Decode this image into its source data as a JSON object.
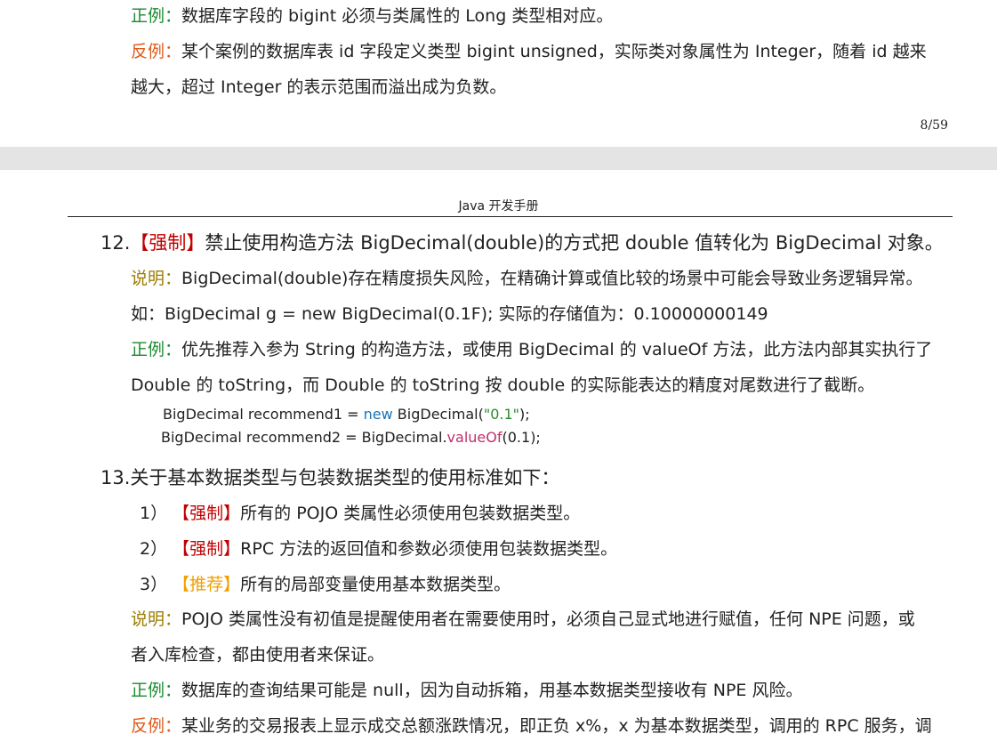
{
  "page_top": {
    "correct_label": "正例：",
    "correct_text": "数据库字段的 bigint 必须与类属性的 Long 类型相对应。",
    "counter_label": "反例：",
    "counter_text_1": "某个案例的数据库表 id 字段定义类型 bigint unsigned，实际类对象属性为 Integer，随着 id 越来",
    "counter_text_2": "越大，超过 Integer 的表示范围而溢出成为负数。",
    "page_number": "8/59"
  },
  "page_bottom": {
    "running_header": "Java 开发手册",
    "item12": {
      "number": "12.",
      "tag": "【强制】",
      "title": "禁止使用构造方法 BigDecimal(double)的方式把 double 值转化为 BigDecimal 对象。",
      "note_label": "说明：",
      "note_text": "BigDecimal(double)存在精度损失风险，在精确计算或值比较的场景中可能会导致业务逻辑异常。",
      "example_line": "如：BigDecimal g = new BigDecimal(0.1F); 实际的存储值为：0.10000000149",
      "correct_label": "正例：",
      "correct_text_1": "优先推荐入参为 String 的构造方法，或使用 BigDecimal 的 valueOf 方法，此方法内部其实执行了",
      "correct_text_2": "Double 的 toString，而 Double 的 toString 按 double 的实际能表达的精度对尾数进行了截断。",
      "code1": {
        "a": "BigDecimal recommend1 = ",
        "kw": "new",
        "b": " BigDecimal(",
        "str": "\"0.1\"",
        "c": ");"
      },
      "code2": {
        "a": "BigDecimal recommend2 = BigDecimal.",
        "fn": "valueOf",
        "b": "(",
        "num": "0.1",
        "c": ");"
      }
    },
    "item13": {
      "title": "13.关于基本数据类型与包装数据类型的使用标准如下：",
      "subs": [
        {
          "num": "1）",
          "tag": "【强制】",
          "text": "所有的 POJO 类属性必须使用包装数据类型。"
        },
        {
          "num": "2）",
          "tag": "【强制】",
          "text": "RPC 方法的返回值和参数必须使用包装数据类型。"
        },
        {
          "num": "3）",
          "tag": "【推荐】",
          "text": "所有的局部变量使用基本数据类型。"
        }
      ],
      "note_label": "说明：",
      "note_text_1": "POJO 类属性没有初值是提醒使用者在需要使用时，必须自己显式地进行赋值，任何 NPE 问题，或",
      "note_text_2": "者入库检查，都由使用者来保证。",
      "correct_label": "正例：",
      "correct_text": "数据库的查询结果可能是 null，因为自动拆箱，用基本数据类型接收有 NPE 风险。",
      "counter_label": "反例：",
      "counter_text": "某业务的交易报表上显示成交总额涨跌情况，即正负 x%，x 为基本数据类型，调用的 RPC 服务，调"
    }
  },
  "colors": {
    "correct": "#1b8a2e",
    "counter": "#e05a1a",
    "note": "#9c7d00",
    "mandatory": "#c00000",
    "recommended": "#f0a000",
    "gap": "#e4e4e4"
  }
}
